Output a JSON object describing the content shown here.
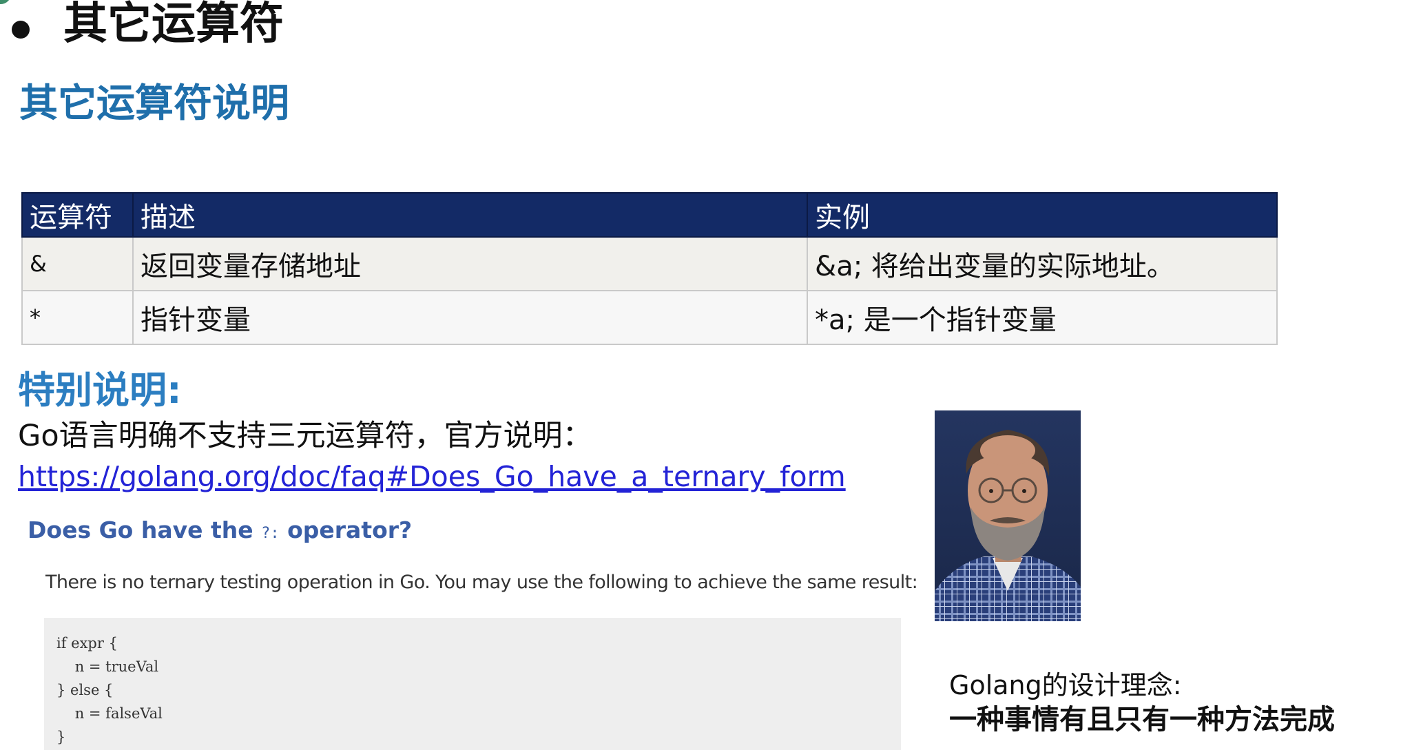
{
  "heading": {
    "title": "其它运算符",
    "subtitle": "其它运算符说明"
  },
  "operator_table": {
    "headers": [
      "运算符",
      "描述",
      "实例"
    ],
    "rows": [
      {
        "operator": "&",
        "description": "返回变量存储地址",
        "example": "&a; 将给出变量的实际地址。"
      },
      {
        "operator": "*",
        "description": "指针变量",
        "example": "*a; 是一个指针变量"
      }
    ]
  },
  "special_note": {
    "heading": "特别说明:",
    "text": "Go语言明确不支持三元运算符，官方说明：",
    "link": "https://golang.org/doc/faq#Does_Go_have_a_ternary_form"
  },
  "faq_excerpt": {
    "question_before": "Does Go have the ",
    "question_operator": "?:",
    "question_after": " operator?",
    "answer": "There is no ternary testing operation in Go. You may use the following to achieve the same result:",
    "code_lines": [
      "if expr {",
      "    n = trueVal",
      "} else {",
      "    n = falseVal",
      "}"
    ]
  },
  "design_philosophy": {
    "label": "Golang的设计理念:",
    "text": "一种事情有且只有一种方法完成"
  },
  "colors": {
    "table_header_bg": "#132a66",
    "subtitle_blue": "#1f6fab",
    "special_heading_blue": "#2c7ec1",
    "link_blue": "#2323d6",
    "faq_question_blue": "#3a5ea6"
  }
}
